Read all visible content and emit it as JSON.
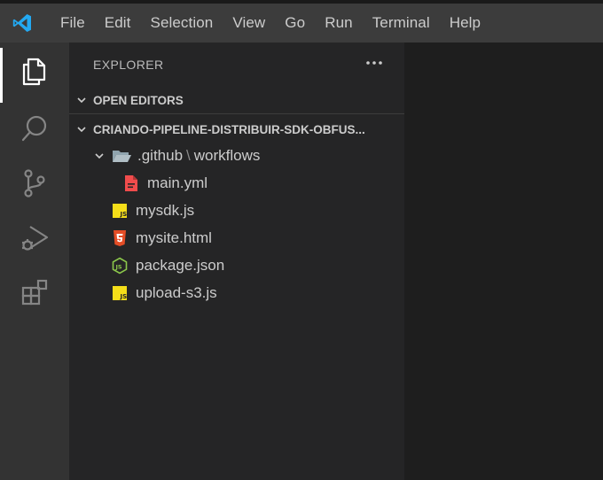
{
  "menu": [
    "File",
    "Edit",
    "Selection",
    "View",
    "Go",
    "Run",
    "Terminal",
    "Help"
  ],
  "activity_bar": [
    {
      "name": "explorer",
      "icon": "files-icon",
      "active": true
    },
    {
      "name": "search",
      "icon": "search-icon",
      "active": false
    },
    {
      "name": "source-control",
      "icon": "source-control-icon",
      "active": false
    },
    {
      "name": "run-debug",
      "icon": "run-debug-icon",
      "active": false
    },
    {
      "name": "extensions",
      "icon": "extensions-icon",
      "active": false
    }
  ],
  "sidebar": {
    "title": "EXPLORER",
    "more_icon": "ellipsis-icon",
    "open_editors": "OPEN EDITORS",
    "folder": "CRIANDO-PIPELINE-DISTRIBUIR-SDK-OBFUS...",
    "tree": {
      "github_folder": ".github",
      "github_sep": "\\",
      "workflows_folder": "workflows",
      "files": [
        {
          "name": "main.yml",
          "icon": "yaml-file-icon",
          "color": "#f14c4c"
        },
        {
          "name": "mysdk.js",
          "icon": "js-file-icon",
          "color": "#f5de19"
        },
        {
          "name": "mysite.html",
          "icon": "html-file-icon",
          "color": "#e44d26"
        },
        {
          "name": "package.json",
          "icon": "nodejs-file-icon",
          "color": "#8cc84b"
        },
        {
          "name": "upload-s3.js",
          "icon": "js-file-icon",
          "color": "#f5de19"
        }
      ]
    }
  },
  "colors": {
    "accent": "#0078d4",
    "titlebar": "#3c3c3c",
    "activitybar": "#333333",
    "sidebar": "#252526",
    "editor": "#1e1e1e"
  }
}
